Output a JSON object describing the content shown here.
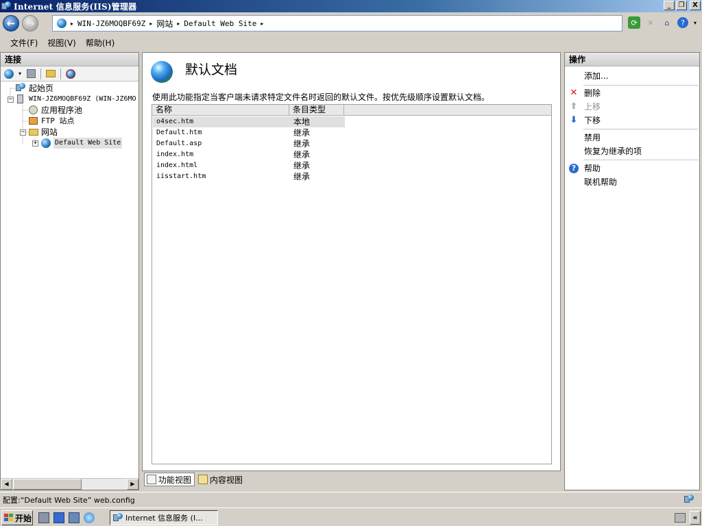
{
  "window": {
    "title": "Internet 信息服务(IIS)管理器",
    "buttons": {
      "minimize": "_",
      "restore": "❐",
      "close": "X"
    }
  },
  "address": {
    "crumbs": [
      "WIN-JZ6MOQBF69Z",
      "网站",
      "Default Web Site"
    ],
    "separator": "▸"
  },
  "menu": {
    "items": [
      "文件(F)",
      "视图(V)",
      "帮助(H)"
    ]
  },
  "left": {
    "heading": "连接",
    "tree": [
      {
        "label": "起始页",
        "level": 0
      },
      {
        "label": "WIN-JZ6MOQBF69Z (WIN-JZ6MO",
        "level": 0
      },
      {
        "label": "应用程序池",
        "level": 1
      },
      {
        "label": "FTP 站点",
        "level": 1
      },
      {
        "label": "网站",
        "level": 1
      },
      {
        "label": "Default Web Site",
        "level": 2
      }
    ],
    "expanders": {
      "server": "−",
      "sites": "−",
      "site": "+"
    },
    "scroll": {
      "left": "◀",
      "right": "▶"
    }
  },
  "center": {
    "title": "默认文档",
    "description": "使用此功能指定当客户端未请求特定文件名时返回的默认文件。按优先级顺序设置默认文档。",
    "columns": [
      "名称",
      "条目类型"
    ],
    "rows": [
      {
        "name": "o4sec.htm",
        "type": "本地"
      },
      {
        "name": "Default.htm",
        "type": "继承"
      },
      {
        "name": "Default.asp",
        "type": "继承"
      },
      {
        "name": "index.htm",
        "type": "继承"
      },
      {
        "name": "index.html",
        "type": "继承"
      },
      {
        "name": "iisstart.htm",
        "type": "继承"
      }
    ]
  },
  "view_tabs": [
    "功能视图",
    "内容视图"
  ],
  "right": {
    "heading": "操作",
    "actions": [
      "添加...",
      "删除",
      "上移",
      "下移",
      "禁用",
      "恢复为继承的项",
      "帮助",
      "联机帮助"
    ],
    "icons": {
      "delete": "✕",
      "up": "⬆",
      "down": "⬇",
      "help": "?"
    }
  },
  "status": {
    "text": "配置:“Default Web Site” web.config"
  },
  "taskbar": {
    "start": "开始",
    "item": "Internet 信息服务 (I...",
    "collapse": "«"
  },
  "colors": {
    "titlebar_start": "#0a246a",
    "delete_red": "#d01010",
    "arrow_blue": "#2a6ad0",
    "disabled_gray": "#909090"
  }
}
